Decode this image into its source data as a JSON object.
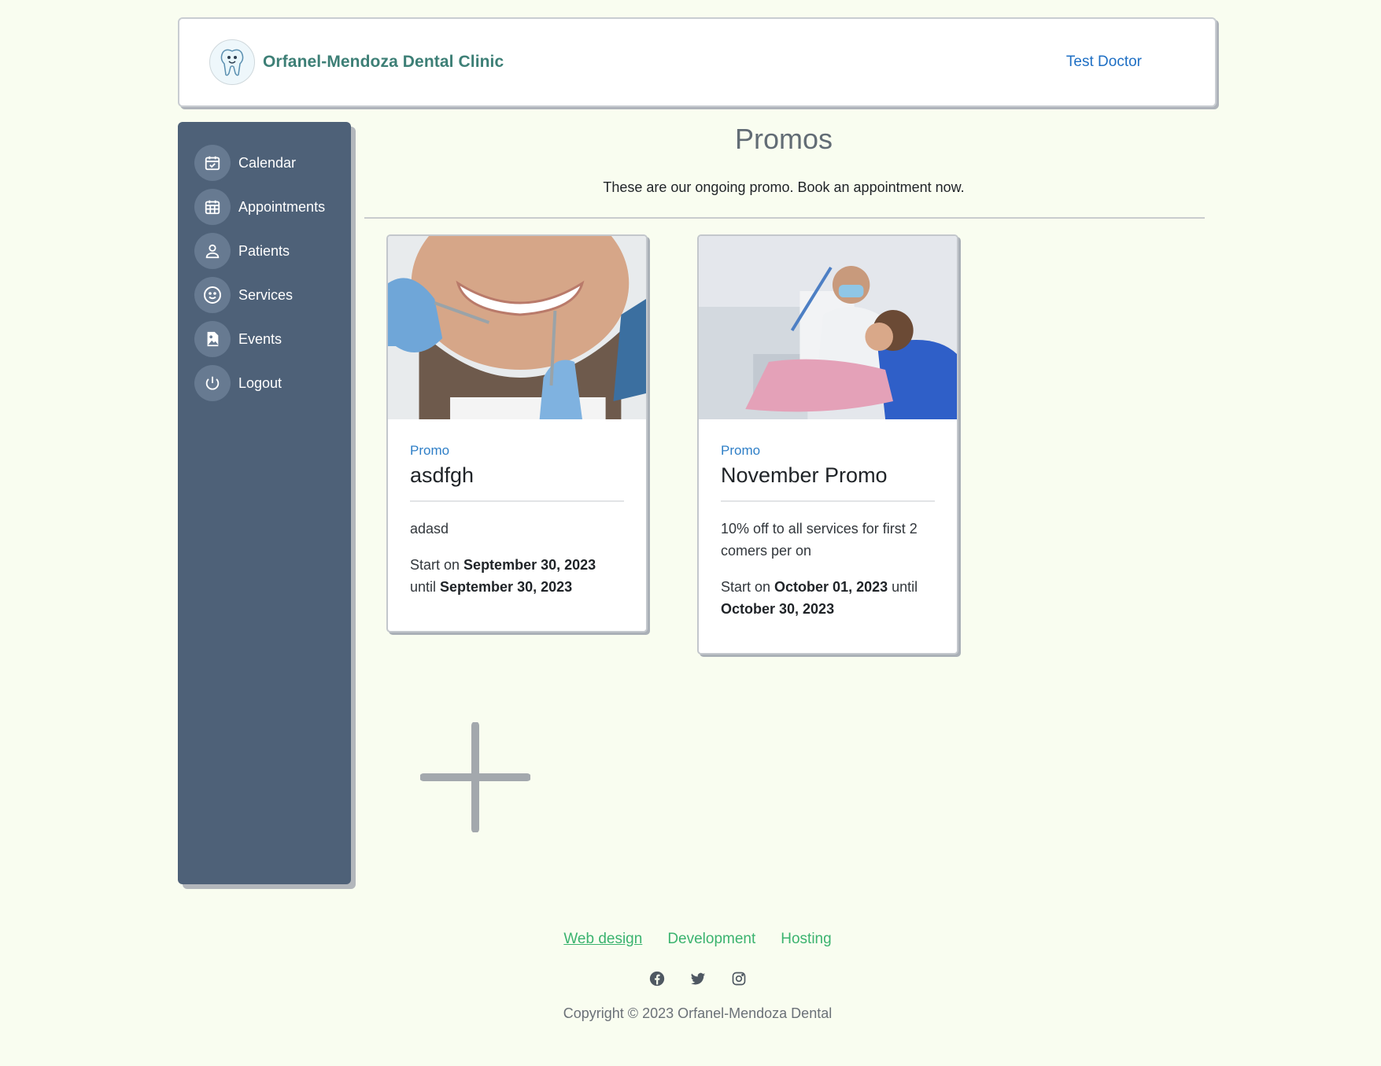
{
  "header": {
    "brand": "Orfanel-Mendoza Dental Clinic",
    "user": "Test Doctor"
  },
  "sidebar": {
    "items": [
      {
        "label": "Calendar",
        "icon": "calendar-check-icon"
      },
      {
        "label": "Appointments",
        "icon": "calendar-grid-icon"
      },
      {
        "label": "Patients",
        "icon": "person-icon"
      },
      {
        "label": "Services",
        "icon": "smile-icon"
      },
      {
        "label": "Events",
        "icon": "image-file-icon"
      },
      {
        "label": "Logout",
        "icon": "power-icon"
      }
    ]
  },
  "main": {
    "title": "Promos",
    "subtitle": "These are our ongoing promo. Book an appointment now.",
    "promos": [
      {
        "kicker": "Promo",
        "title": "asdfgh",
        "description": "adasd",
        "start_prefix": "Start on ",
        "start_date": "September 30, 2023",
        "until": " until ",
        "end_date": "September 30, 2023"
      },
      {
        "kicker": "Promo",
        "title": "November Promo",
        "description": "10% off to all services for first 2 comers per on",
        "start_prefix": "Start on ",
        "start_date": "October 01, 2023",
        "until": " until ",
        "end_date": "October 30, 2023"
      }
    ]
  },
  "footer": {
    "links": [
      "Web design",
      "Development",
      "Hosting"
    ],
    "socials": [
      "facebook-icon",
      "twitter-icon",
      "instagram-icon"
    ],
    "copyright": "Copyright © 2023 Orfanel-Mendoza Dental"
  },
  "colors": {
    "background": "#f9fdf0",
    "sidebar": "#4e6178",
    "brand": "#3d7f76",
    "link": "#1e6fc4",
    "footer_link": "#3bb36f"
  }
}
